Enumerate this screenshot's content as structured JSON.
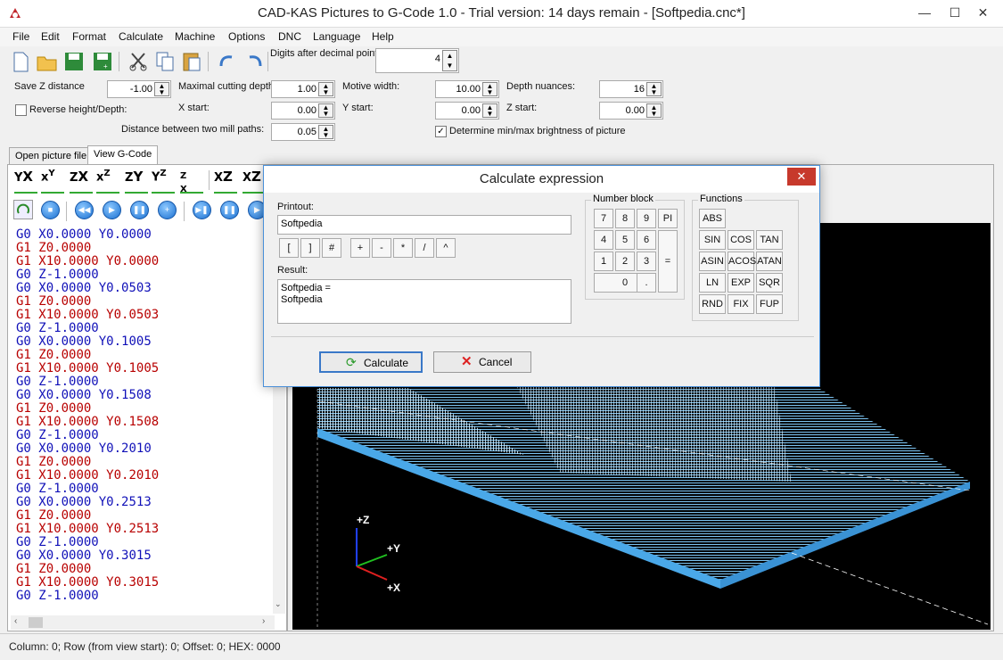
{
  "window": {
    "title": "CAD-KAS Pictures to G-Code 1.0 - Trial version: 14 days remain - [Softpedia.cnc*]"
  },
  "menu": [
    "File",
    "Edit",
    "Format",
    "Calculate",
    "Machine",
    "Options",
    "DNC",
    "Language",
    "Help"
  ],
  "params": {
    "digits_label": "Digits after decimal point:",
    "digits_value": "4",
    "savez_label": "Save Z distance",
    "savez_value": "-1.00",
    "maxcut_label": "Maximal cutting depth",
    "maxcut_value": "1.00",
    "motive_label": "Motive width:",
    "motive_value": "10.00",
    "depthn_label": "Depth nuances:",
    "depthn_value": "16",
    "reverse_label": "Reverse height/Depth:",
    "xstart_label": "X start:",
    "xstart_value": "0.00",
    "ystart_label": "Y start:",
    "ystart_value": "0.00",
    "zstart_label": "Z start:",
    "zstart_value": "0.00",
    "dist_label": "Distance between two mill paths:",
    "dist_value": "0.05",
    "determine_label": "Determine min/max brightness of picture"
  },
  "tabs": [
    "Open picture file",
    "View G-Code"
  ],
  "gcode": [
    [
      "G0",
      "X0.0000",
      "Y0.0000"
    ],
    [
      "G1",
      "Z0.0000",
      ""
    ],
    [
      "G1",
      "X10.0000",
      "Y0.0000"
    ],
    [
      "G0",
      "Z-1.0000",
      ""
    ],
    [
      "G0",
      "X0.0000",
      "Y0.0503"
    ],
    [
      "G1",
      "Z0.0000",
      ""
    ],
    [
      "G1",
      "X10.0000",
      "Y0.0503"
    ],
    [
      "G0",
      "Z-1.0000",
      ""
    ],
    [
      "G0",
      "X0.0000",
      "Y0.1005"
    ],
    [
      "G1",
      "Z0.0000",
      ""
    ],
    [
      "G1",
      "X10.0000",
      "Y0.1005"
    ],
    [
      "G0",
      "Z-1.0000",
      ""
    ],
    [
      "G0",
      "X0.0000",
      "Y0.1508"
    ],
    [
      "G1",
      "Z0.0000",
      ""
    ],
    [
      "G1",
      "X10.0000",
      "Y0.1508"
    ],
    [
      "G0",
      "Z-1.0000",
      ""
    ],
    [
      "G0",
      "X0.0000",
      "Y0.2010"
    ],
    [
      "G1",
      "Z0.0000",
      ""
    ],
    [
      "G1",
      "X10.0000",
      "Y0.2010"
    ],
    [
      "G0",
      "Z-1.0000",
      ""
    ],
    [
      "G0",
      "X0.0000",
      "Y0.2513"
    ],
    [
      "G1",
      "Z0.0000",
      ""
    ],
    [
      "G1",
      "X10.0000",
      "Y0.2513"
    ],
    [
      "G0",
      "Z-1.0000",
      ""
    ],
    [
      "G0",
      "X0.0000",
      "Y0.3015"
    ],
    [
      "G1",
      "Z0.0000",
      ""
    ],
    [
      "G1",
      "X10.0000",
      "Y0.3015"
    ],
    [
      "G0",
      "Z-1.0000",
      ""
    ]
  ],
  "axes": {
    "z": "+Z",
    "y": "+Y",
    "x": "+X"
  },
  "status": "Column: 0; Row (from view start): 0; Offset: 0; HEX: 0000",
  "dialog": {
    "title": "Calculate expression",
    "printout_label": "Printout:",
    "printout_value": "Softpedia",
    "result_label": "Result:",
    "result_lines": [
      "Softpedia =",
      "Softpedia"
    ],
    "ops": [
      "[",
      "]",
      "#",
      "+",
      "-",
      "*",
      "/",
      "^"
    ],
    "numblock_label": "Number block",
    "numkeys": [
      "7",
      "8",
      "9",
      "PI",
      "4",
      "5",
      "6",
      "1",
      "2",
      "3",
      "=",
      "0",
      "."
    ],
    "functions_label": "Functions",
    "funcs": [
      "ABS",
      "SIN",
      "COS",
      "TAN",
      "ASIN",
      "ACOS",
      "ATAN",
      "LN",
      "EXP",
      "SQR",
      "RND",
      "FIX",
      "FUP"
    ],
    "calculate": "Calculate",
    "cancel": "Cancel"
  },
  "colors": {
    "g0": "#1010b8",
    "g1": "#b80000",
    "mesh": "#4aa8e8",
    "accent": "#4a90d9"
  }
}
